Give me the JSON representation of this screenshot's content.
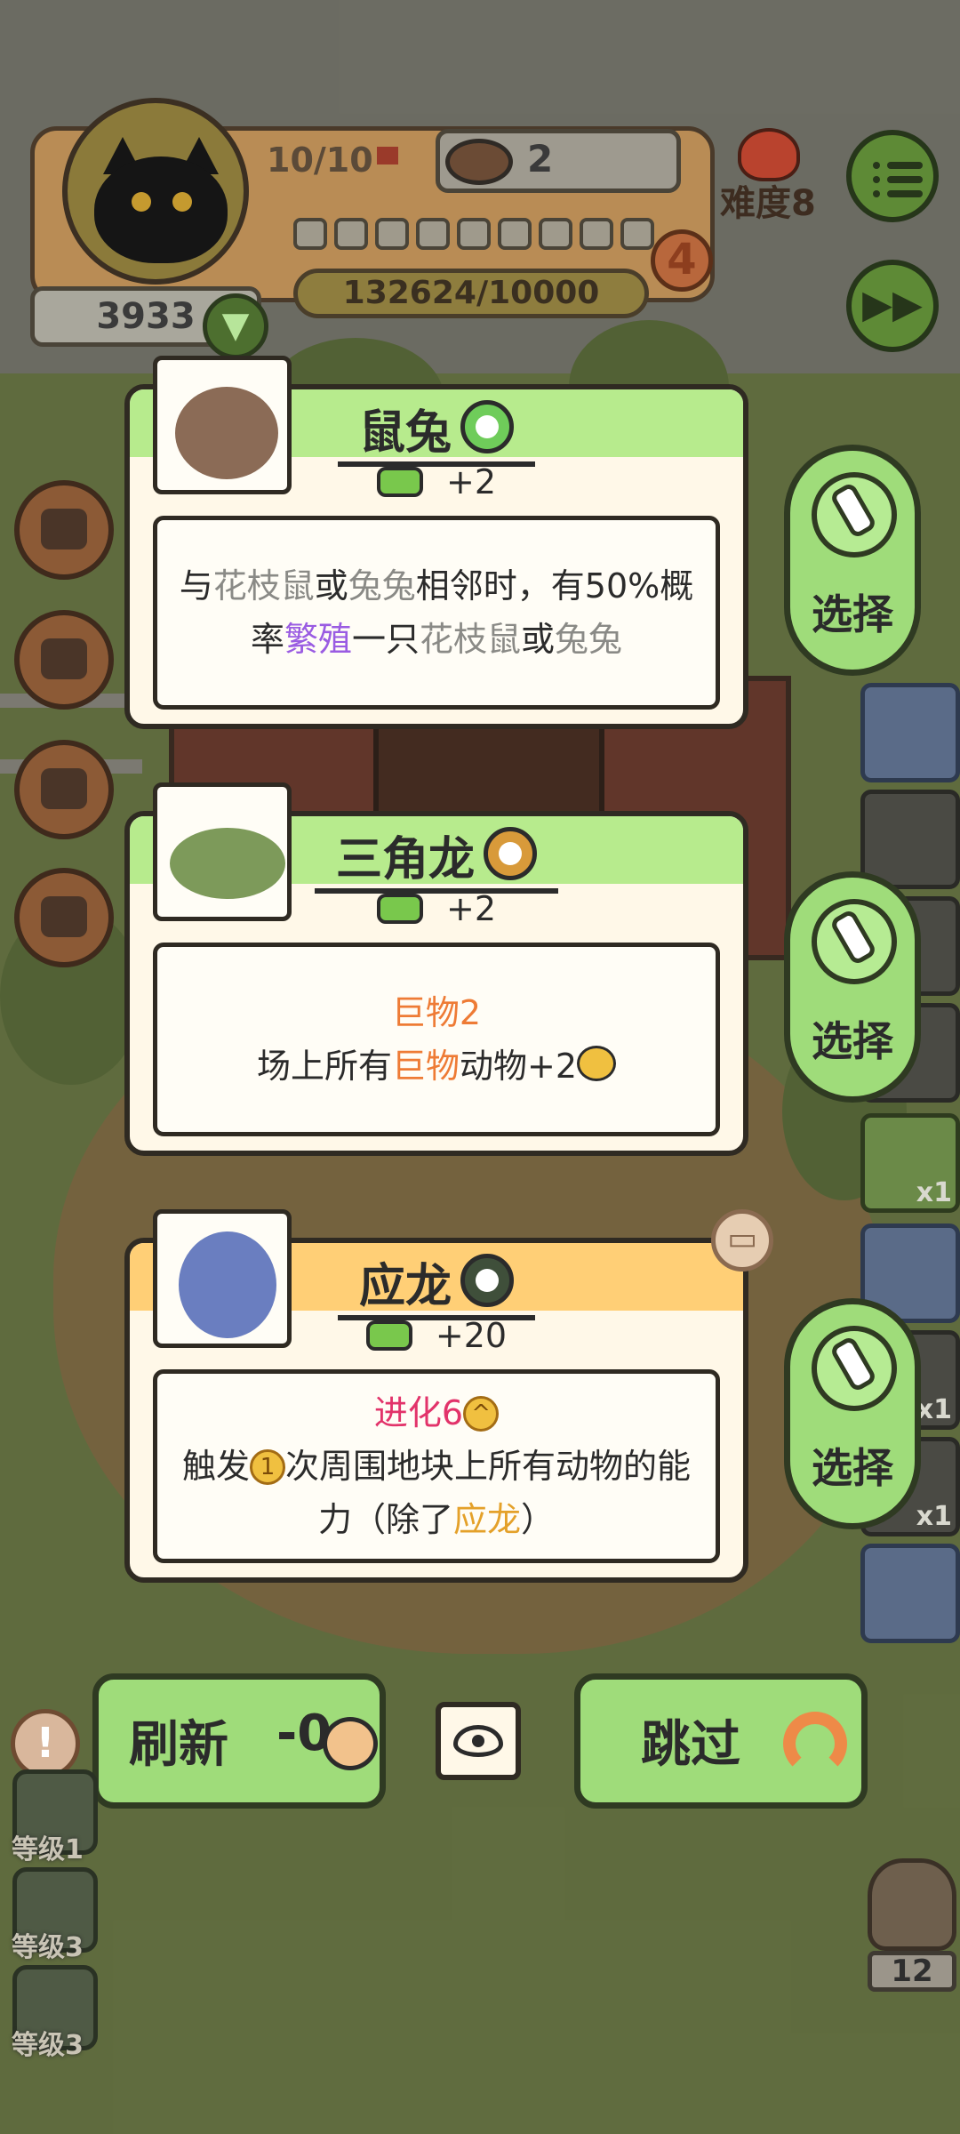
{
  "hud": {
    "coins": "3933",
    "flags": "10/10",
    "bowls": "2",
    "progress_text": "132624/10000",
    "level": "4",
    "difficulty": "难度8",
    "segments_filled": 0,
    "segments_total": 9
  },
  "cards": [
    {
      "name": "鼠兔",
      "header_color": "#b7eb8d",
      "bonus": "+2",
      "description_lines": [
        [
          {
            "text": "与",
            "style": ""
          },
          {
            "text": "花枝鼠",
            "style": "gray"
          },
          {
            "text": "或",
            "style": ""
          },
          {
            "text": "兔兔",
            "style": "gray"
          },
          {
            "text": "相邻时，有50%概",
            "style": ""
          }
        ],
        [
          {
            "text": "率",
            "style": ""
          },
          {
            "text": "繁殖",
            "style": "purple"
          },
          {
            "text": "一只",
            "style": ""
          },
          {
            "text": "花枝鼠",
            "style": "gray"
          },
          {
            "text": "或",
            "style": ""
          },
          {
            "text": "兔兔",
            "style": "gray"
          }
        ]
      ],
      "select_label": "选择"
    },
    {
      "name": "三角龙",
      "header_color": "#b7eb8d",
      "bonus": "+2",
      "subtitle": "巨物2",
      "line_prefix": "场上所有",
      "line_highlight": "巨物",
      "line_suffix": "动物+2",
      "select_label": "选择"
    },
    {
      "name": "应龙",
      "header_color": "#ffcf76",
      "bonus": "+20",
      "subtitle": "进化6",
      "line1_prefix": "触发",
      "line1_coin": "1",
      "line1_suffix": "次周围地块上所有动物的能",
      "line2_prefix": "力（除了",
      "line2_highlight": "应龙",
      "line2_suffix": "）",
      "select_label": "选择"
    }
  ],
  "actions": {
    "refresh_label": "刷新",
    "refresh_cost": "-0",
    "skip_label": "跳过"
  },
  "side_levels": [
    "等级1",
    "等级3",
    "等级3"
  ],
  "right_slots": {
    "slot_count_a": "x1",
    "slot_count_b": "x1",
    "slot_count_c": "x1"
  },
  "owl_count": "12",
  "alert_symbol": "!"
}
